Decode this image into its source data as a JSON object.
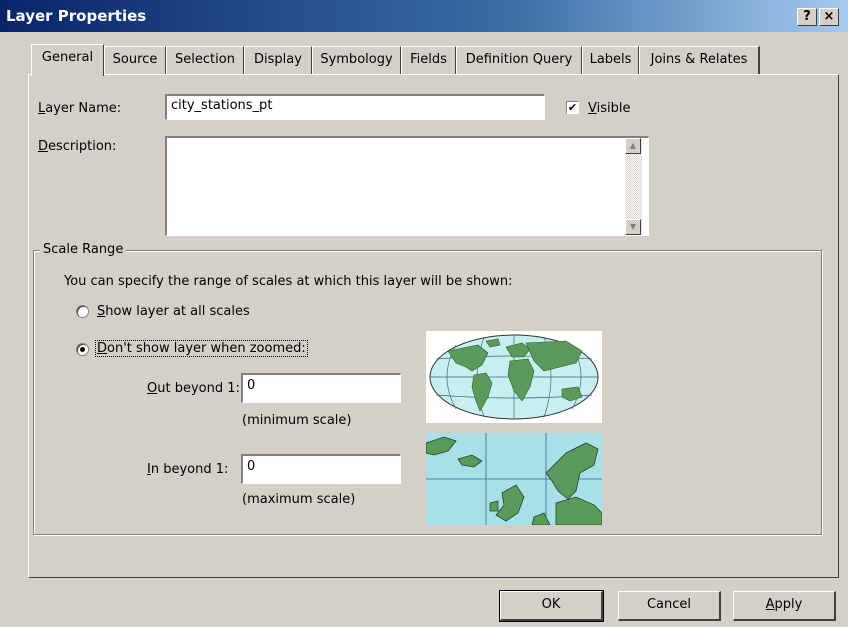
{
  "window": {
    "title": "Layer Properties",
    "help_label": "?",
    "close_label": "×"
  },
  "tabs": [
    {
      "label": "General"
    },
    {
      "label": "Source"
    },
    {
      "label": "Selection"
    },
    {
      "label": "Display"
    },
    {
      "label": "Symbology"
    },
    {
      "label": "Fields"
    },
    {
      "label": "Definition Query"
    },
    {
      "label": "Labels"
    },
    {
      "label": "Joins & Relates"
    }
  ],
  "general": {
    "layer_name_label_prefix": "L",
    "layer_name_label_rest": "ayer Name:",
    "layer_name_value": "city_stations_pt",
    "visible_checked_mark": "✔",
    "visible_label_prefix": "V",
    "visible_label_rest": "isible",
    "description_label_prefix": "D",
    "description_label_rest": "escription:",
    "description_value": ""
  },
  "scale_range": {
    "group_title": "Scale Range",
    "intro": "You can specify the range of scales at which this layer will be shown:",
    "option_all_prefix": "S",
    "option_all_rest": "how layer at all scales",
    "option_zoomed_prefix": "D",
    "option_zoomed_rest": "on't show layer when zoomed:",
    "out_beyond_prefix": "O",
    "out_beyond_rest": "ut beyond  1:",
    "out_beyond_value": "0",
    "out_beyond_hint": "(minimum scale)",
    "in_beyond_prefix": "I",
    "in_beyond_rest": "n beyond  1:",
    "in_beyond_value": "0",
    "in_beyond_hint": "(maximum scale)"
  },
  "buttons": {
    "ok": "OK",
    "cancel": "Cancel",
    "apply_prefix": "A",
    "apply_rest": "pply"
  },
  "colors": {
    "title_bar": "#0a246a",
    "map_land": "#5a9a5a",
    "map_ocean_light": "#c8eef0",
    "map_ocean": "#a8e0e8"
  }
}
